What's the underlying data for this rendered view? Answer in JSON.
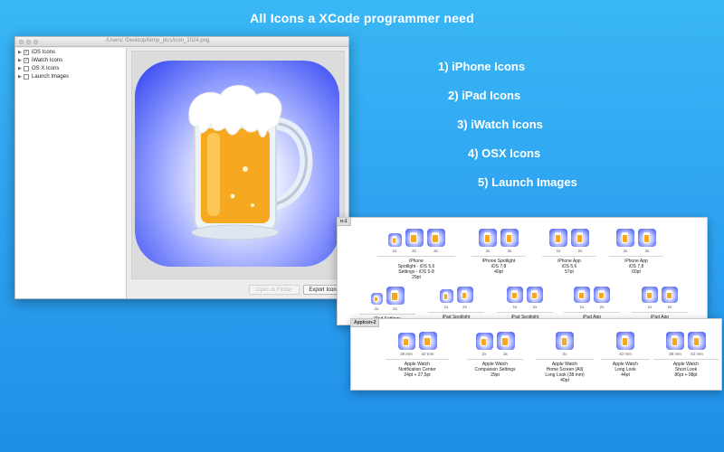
{
  "headline": "All Icons a XCode programmer need",
  "features": [
    "1) iPhone Icons",
    "2) iPad Icons",
    "3) iWatch Icons",
    "4) OSX Icons",
    "5) Launch Images"
  ],
  "window": {
    "path": "/Users/            /Desktop/temp_pics/icon_1024.png",
    "tree": [
      {
        "label": "iOS Icons",
        "checked": "✓"
      },
      {
        "label": "iWatch Icons",
        "checked": "✓"
      },
      {
        "label": "OS X Icons",
        "checked": ""
      },
      {
        "label": "Launch Images",
        "checked": ""
      }
    ],
    "open_in_finder": "Open in Finder",
    "export_icons": "Export Icons"
  },
  "panel1": {
    "tag": "n-1",
    "groups_row1": [
      {
        "scales": [
          "1x",
          "2x",
          "3x"
        ],
        "caption": [
          "iPhone",
          "Spotlight - iOS 5,6",
          "Settings - iOS 5-8",
          "29pt"
        ]
      },
      {
        "scales": [
          "2x",
          "3x"
        ],
        "caption": [
          "iPhone Spotlight",
          "iOS 7,8",
          "40pt"
        ]
      },
      {
        "scales": [
          "1x",
          "2x"
        ],
        "caption": [
          "iPhone App",
          "iOS 5,6",
          "57pt"
        ]
      },
      {
        "scales": [
          "2x",
          "3x"
        ],
        "caption": [
          "iPhone App",
          "iOS 7,8",
          "60pt"
        ]
      }
    ],
    "groups_row2": [
      {
        "scales": [
          "1x",
          "2x"
        ],
        "caption": [
          "iPad Settings"
        ]
      },
      {
        "scales": [
          "1x",
          "2x"
        ],
        "caption": [
          "iPad Spotlight"
        ]
      },
      {
        "scales": [
          "1x",
          "2x"
        ],
        "caption": [
          "iPad Spotlight"
        ]
      },
      {
        "scales": [
          "1x",
          "2x"
        ],
        "caption": [
          "iPad App"
        ]
      },
      {
        "scales": [
          "1x",
          "2x"
        ],
        "caption": [
          "iPad App"
        ]
      }
    ]
  },
  "panel2": {
    "tag": "AppIcon-2",
    "groups": [
      {
        "scales": [
          "38 mm",
          "42 mm"
        ],
        "caption": [
          "Apple Watch",
          "Notification Center",
          "24pt + 27,5pt"
        ]
      },
      {
        "scales": [
          "2x",
          "3x"
        ],
        "caption": [
          "Apple Watch",
          "Companion Settings",
          "29pt"
        ]
      },
      {
        "scales": [
          "2x"
        ],
        "caption": [
          "Apple Watch",
          "Home Screen (All)",
          "Long Look (38 mm)",
          "40pt"
        ]
      },
      {
        "scales": [
          "42 mm"
        ],
        "caption": [
          "Apple Watch",
          "Long Look",
          "44pt"
        ]
      },
      {
        "scales": [
          "38 mm",
          "42 mm"
        ],
        "caption": [
          "Apple Watch",
          "Short Look",
          "86pt + 98pt"
        ]
      }
    ]
  },
  "colors": {
    "background": "#2fa4f2",
    "icon_blue": "#2a3ef0",
    "beer": "#f6a820"
  },
  "icons": {
    "beer_mug": "beer-mug-icon",
    "expand": "disclosure-triangle-icon"
  }
}
